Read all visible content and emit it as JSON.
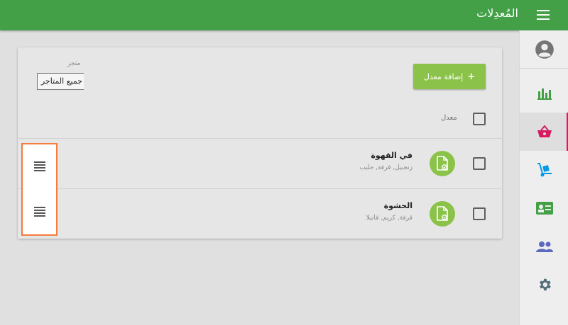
{
  "header": {
    "title": "المُعدِلات",
    "menu_icon": "menu-icon"
  },
  "sidebar": {
    "items": [
      {
        "icon": "account-circle-icon",
        "color": "#757575"
      },
      {
        "icon": "bar-chart-icon",
        "color": "#43a047"
      },
      {
        "icon": "shopping-basket-icon",
        "color": "#d81b60",
        "active": true
      },
      {
        "icon": "dolly-icon",
        "color": "#039be5"
      },
      {
        "icon": "id-card-icon",
        "color": "#43a047"
      },
      {
        "icon": "people-icon",
        "color": "#5c6bc0"
      },
      {
        "icon": "settings-icon",
        "color": "#546e7a"
      }
    ]
  },
  "toolbar": {
    "add_label": "إضافة معدل",
    "add_icon": "plus-icon"
  },
  "filter": {
    "store_label": "متجر",
    "store_value": "جميع المتاجر"
  },
  "list": {
    "header_label": "معدل",
    "rows": [
      {
        "name": "في القهوة",
        "desc": "زنجبيل, قرفة, حليب"
      },
      {
        "name": "الحشوة",
        "desc": "قرفة, كريم, فانيلا"
      }
    ]
  },
  "colors": {
    "primary": "#43a047",
    "accent": "#8bc34a",
    "active": "#d81b60",
    "highlight": "#f47c3c"
  }
}
